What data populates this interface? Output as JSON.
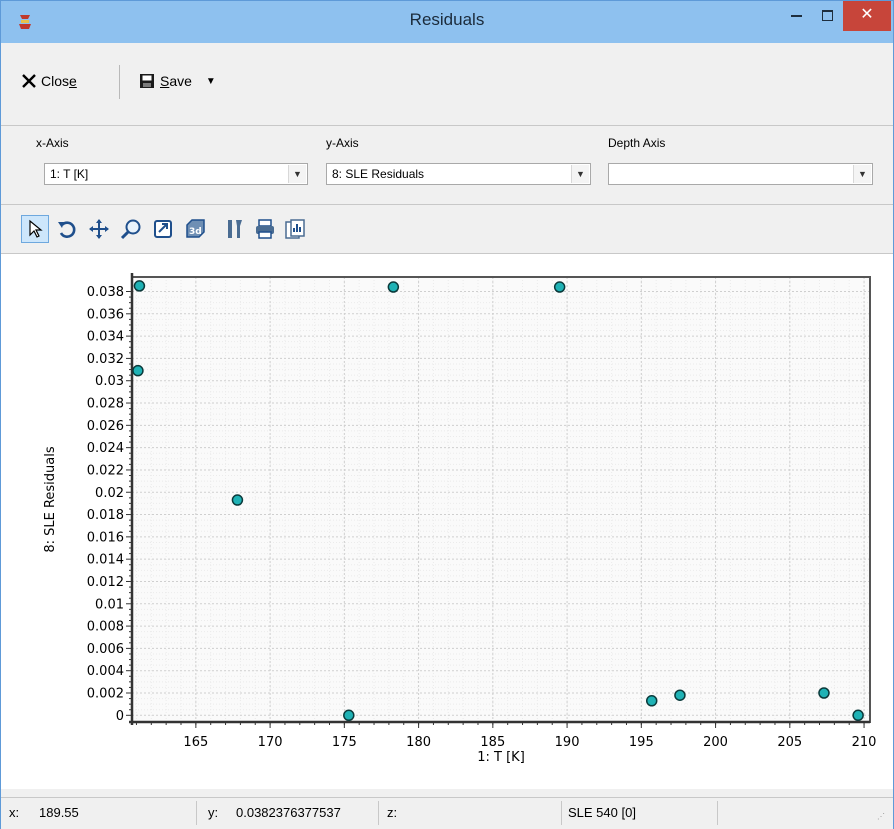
{
  "window": {
    "title": "Residuals"
  },
  "toolbar": {
    "close_label_pre": "Clos",
    "close_label_u": "e",
    "save_label_u": "S",
    "save_label_post": "ave"
  },
  "axes": {
    "x_label": "x-Axis",
    "x_value": "1: T [K]",
    "y_label": "y-Axis",
    "y_value": "8: SLE Residuals",
    "depth_label": "Depth Axis",
    "depth_value": ""
  },
  "chart_toolbar": {
    "icons": [
      "pointer-icon",
      "rotate-icon",
      "pan-icon",
      "zoom-icon",
      "zoom-box-icon",
      "3d-icon",
      "properties-icon",
      "print-icon",
      "copy-chart-icon"
    ]
  },
  "chart_data": {
    "type": "scatter",
    "xlabel": "1: T [K]",
    "ylabel": "8: SLE Residuals",
    "xlim": [
      160.7,
      210.4
    ],
    "ylim": [
      -0.0006,
      0.0393
    ],
    "x_ticks": [
      "165",
      "170",
      "175",
      "180",
      "185",
      "190",
      "195",
      "200",
      "205",
      "210"
    ],
    "x_tick_values": [
      165,
      170,
      175,
      180,
      185,
      190,
      195,
      200,
      205,
      210
    ],
    "y_ticks": [
      "0",
      "0.002",
      "0.004",
      "0.006",
      "0.008",
      "0.01",
      "0.012",
      "0.014",
      "0.016",
      "0.018",
      "0.02",
      "0.022",
      "0.024",
      "0.026",
      "0.028",
      "0.03",
      "0.032",
      "0.034",
      "0.036",
      "0.038"
    ],
    "y_tick_values": [
      0,
      0.002,
      0.004,
      0.006,
      0.008,
      0.01,
      0.012,
      0.014,
      0.016,
      0.018,
      0.02,
      0.022,
      0.024,
      0.026,
      0.028,
      0.03,
      0.032,
      0.034,
      0.036,
      0.038
    ],
    "points": [
      {
        "x": 161.2,
        "y": 0.0385
      },
      {
        "x": 161.1,
        "y": 0.0309
      },
      {
        "x": 167.8,
        "y": 0.0193
      },
      {
        "x": 175.3,
        "y": 0.0
      },
      {
        "x": 178.3,
        "y": 0.0384
      },
      {
        "x": 189.5,
        "y": 0.0384
      },
      {
        "x": 195.7,
        "y": 0.0013
      },
      {
        "x": 197.6,
        "y": 0.0018
      },
      {
        "x": 207.3,
        "y": 0.002
      },
      {
        "x": 209.6,
        "y": 0.0
      }
    ],
    "marker_color": "#1fb2b5",
    "grid": true,
    "minor_grid": true
  },
  "status": {
    "x_label": "x:",
    "x_value": "189.55",
    "y_label": "y:",
    "y_value": "0.0382376377537",
    "z_label": "z:",
    "z_value": "",
    "dataset": "SLE 540 [0]"
  }
}
